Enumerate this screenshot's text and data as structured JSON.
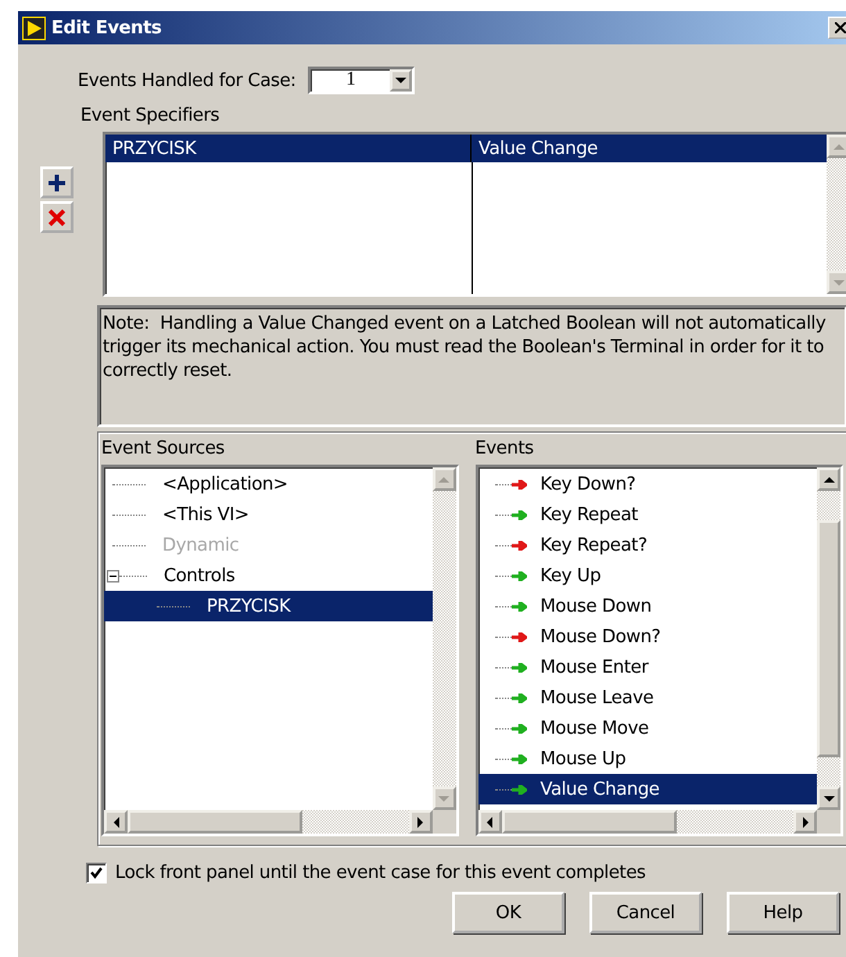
{
  "window": {
    "title": "Edit Events"
  },
  "events_handled": {
    "label": "Events Handled for Case:",
    "value": "1"
  },
  "event_specifiers": {
    "label": "Event Specifiers",
    "rows": [
      {
        "source": "PRZYCISK",
        "event": "Value Change",
        "selected": true
      }
    ]
  },
  "note": "Note:  Handling a Value Changed event on a Latched Boolean will not automatically trigger its mechanical action. You must read the Boolean's Terminal in order for it to correctly reset.",
  "event_sources": {
    "label": "Event Sources",
    "items": [
      {
        "label": "<Application>",
        "disabled": false,
        "selected": false
      },
      {
        "label": "<This VI>",
        "disabled": false,
        "selected": false
      },
      {
        "label": "Dynamic",
        "disabled": true,
        "selected": false
      },
      {
        "label": "Controls",
        "disabled": false,
        "selected": false,
        "expanded": true,
        "children": [
          {
            "label": "PRZYCISK",
            "disabled": false,
            "selected": true
          }
        ]
      }
    ]
  },
  "events": {
    "label": "Events",
    "items": [
      {
        "label": "Key Down?",
        "color": "#e01818",
        "selected": false
      },
      {
        "label": "Key Repeat",
        "color": "#20b020",
        "selected": false
      },
      {
        "label": "Key Repeat?",
        "color": "#e01818",
        "selected": false
      },
      {
        "label": "Key Up",
        "color": "#20b020",
        "selected": false
      },
      {
        "label": "Mouse Down",
        "color": "#20b020",
        "selected": false
      },
      {
        "label": "Mouse Down?",
        "color": "#e01818",
        "selected": false
      },
      {
        "label": "Mouse Enter",
        "color": "#20b020",
        "selected": false
      },
      {
        "label": "Mouse Leave",
        "color": "#20b020",
        "selected": false
      },
      {
        "label": "Mouse Move",
        "color": "#20b020",
        "selected": false
      },
      {
        "label": "Mouse Up",
        "color": "#20b020",
        "selected": false
      },
      {
        "label": "Value Change",
        "color": "#20b020",
        "selected": true
      }
    ]
  },
  "lock_checkbox": {
    "label": "Lock front panel until the event case for this event completes",
    "checked": true
  },
  "buttons": [
    "OK",
    "Cancel",
    "Help"
  ]
}
